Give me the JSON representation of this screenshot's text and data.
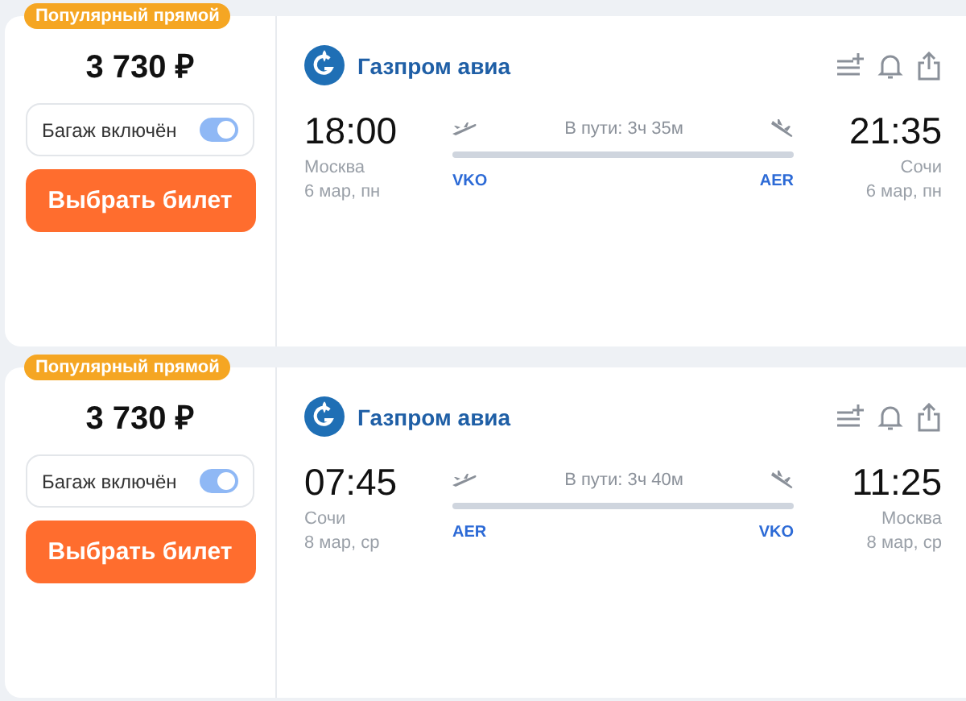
{
  "tickets": [
    {
      "badge": "Популярный прямой",
      "price": "3 730 ₽",
      "baggage": {
        "label": "Багаж включён",
        "on": true
      },
      "button": "Выбрать билет",
      "airline": "Газпром авиа",
      "departure": {
        "time": "18:00",
        "city": "Москва",
        "date": "6 мар, пн",
        "code": "VKO"
      },
      "arrival": {
        "time": "21:35",
        "city": "Сочи",
        "date": "6 мар, пн",
        "code": "AER"
      },
      "duration": "В пути: 3ч 35м"
    },
    {
      "badge": "Популярный прямой",
      "price": "3 730 ₽",
      "baggage": {
        "label": "Багаж включён",
        "on": true
      },
      "button": "Выбрать билет",
      "airline": "Газпром авиа",
      "departure": {
        "time": "07:45",
        "city": "Сочи",
        "date": "8 мар, ср",
        "code": "AER"
      },
      "arrival": {
        "time": "11:25",
        "city": "Москва",
        "date": "8 мар, ср",
        "code": "VKO"
      },
      "duration": "В пути: 3ч 40м"
    }
  ]
}
